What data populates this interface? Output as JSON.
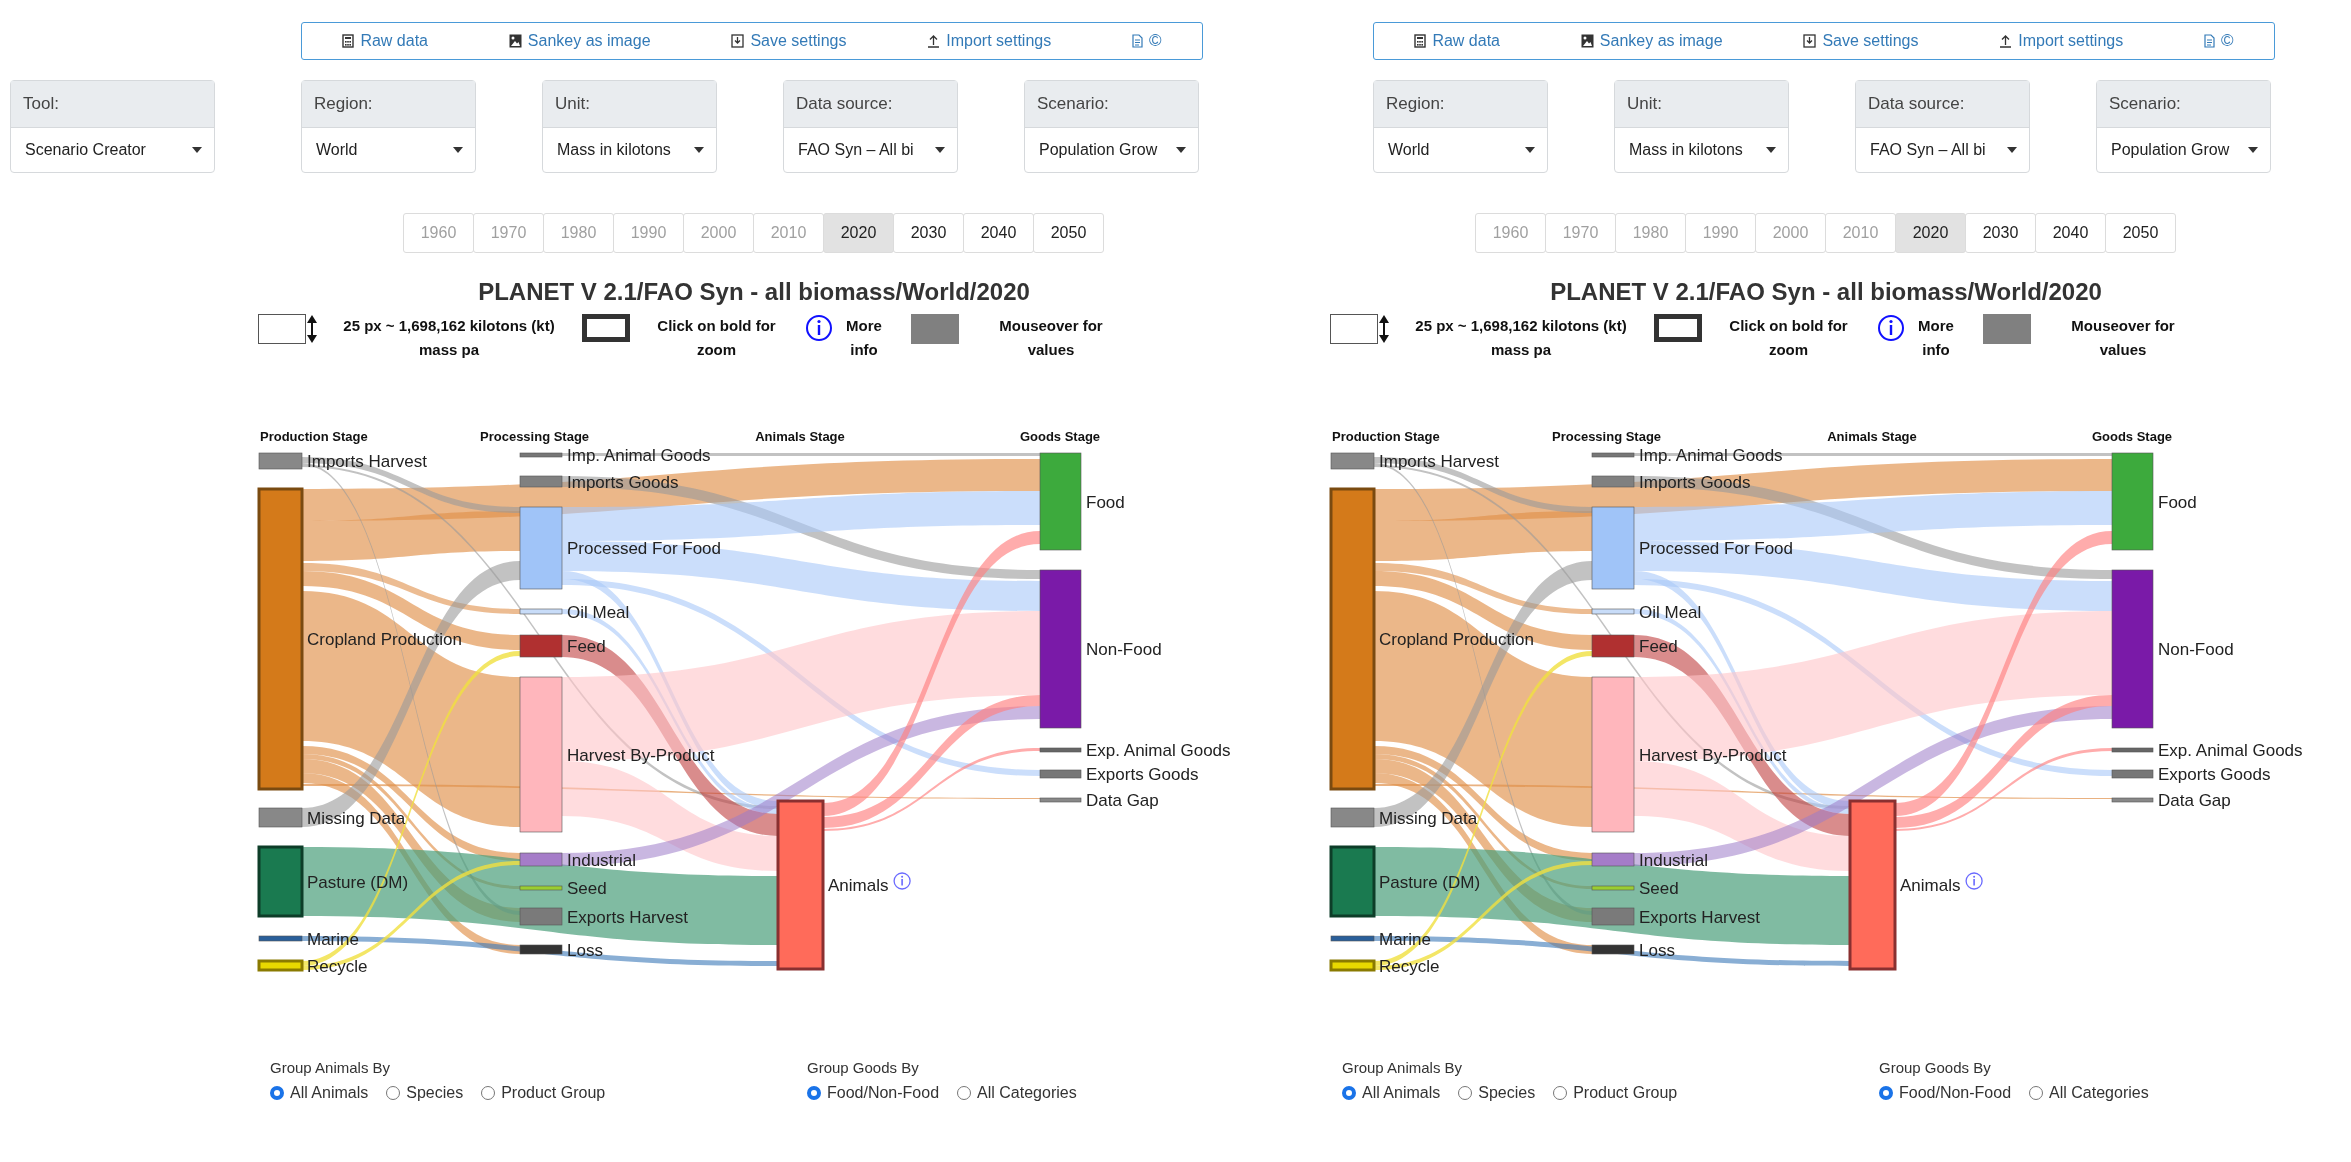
{
  "tool": {
    "label": "Tool:",
    "value": "Scenario Creator"
  },
  "panels": [
    {
      "toolbar": [
        {
          "kind": "calculator",
          "label": "Raw data"
        },
        {
          "kind": "image",
          "label": "Sankey as image"
        },
        {
          "kind": "save",
          "label": "Save settings"
        },
        {
          "kind": "upload",
          "label": "Import settings"
        }
      ],
      "license_mark": "©",
      "dropdowns": [
        {
          "label": "Region:",
          "value": "World"
        },
        {
          "label": "Unit:",
          "value": "Mass in kilotons"
        },
        {
          "label": "Data source:",
          "value": "FAO Syn – All bi"
        },
        {
          "label": "Scenario:",
          "value": "Population Grow"
        }
      ],
      "years": [
        {
          "label": "1960",
          "disabled": true,
          "selected": false
        },
        {
          "label": "1970",
          "disabled": true,
          "selected": false
        },
        {
          "label": "1980",
          "disabled": true,
          "selected": false
        },
        {
          "label": "1990",
          "disabled": true,
          "selected": false
        },
        {
          "label": "2000",
          "disabled": true,
          "selected": false
        },
        {
          "label": "2010",
          "disabled": true,
          "selected": false
        },
        {
          "label": "2020",
          "disabled": false,
          "selected": true
        },
        {
          "label": "2030",
          "disabled": false,
          "selected": false
        },
        {
          "label": "2040",
          "disabled": false,
          "selected": false
        },
        {
          "label": "2050",
          "disabled": false,
          "selected": false
        }
      ],
      "title": "PLANET V 2.1/FAO Syn - all biomass/World/2020",
      "legend": {
        "scale": "25 px ~ 1,698,162 kilotons (kt) mass pa",
        "zoom": "Click on bold for zoom",
        "info": "More info",
        "values": "Mouseover for values"
      },
      "sankey": {
        "stages": [
          {
            "title": "Production Stage",
            "nodes": [
              {
                "label": "Imports Harvest",
                "color": "#888888"
              },
              {
                "label": "Cropland Production",
                "color": "#d47a1a"
              },
              {
                "label": "Missing Data",
                "color": "#888888"
              },
              {
                "label": "Pasture (DM)",
                "color": "#1a7a50"
              },
              {
                "label": "Marine",
                "color": "#2a5f9a"
              },
              {
                "label": "Recycle",
                "color": "#e8d800"
              }
            ]
          },
          {
            "title": "Processing Stage",
            "nodes": [
              {
                "label": "Imp. Animal Goods",
                "color": "#777777"
              },
              {
                "label": "Imports Goods",
                "color": "#808080"
              },
              {
                "label": "Processed For Food",
                "color": "#a0c4f8"
              },
              {
                "label": "Oil Meal",
                "color": "#c8dcf8"
              },
              {
                "label": "Feed",
                "color": "#b03030"
              },
              {
                "label": "Harvest By-Product",
                "color": "#ffb6bc"
              },
              {
                "label": "Industrial",
                "color": "#a57cc8"
              },
              {
                "label": "Seed",
                "color": "#9acd32"
              },
              {
                "label": "Exports Harvest",
                "color": "#7a7a7a"
              },
              {
                "label": "Loss",
                "color": "#333333"
              }
            ]
          },
          {
            "title": "Animals Stage",
            "nodes": [
              {
                "label": "Animals",
                "color": "#ff6b5a",
                "info": true
              }
            ]
          },
          {
            "title": "Goods Stage",
            "nodes": [
              {
                "label": "Food",
                "color": "#3daa3d"
              },
              {
                "label": "Non-Food",
                "color": "#7a1aa8"
              },
              {
                "label": "Exp. Animal Goods",
                "color": "#666666"
              },
              {
                "label": "Exports Goods",
                "color": "#777777"
              },
              {
                "label": "Data Gap",
                "color": "#888888"
              }
            ]
          }
        ]
      },
      "radio_groups": [
        {
          "title": "Group Animals By",
          "options": [
            {
              "label": "All Animals",
              "selected": true
            },
            {
              "label": "Species",
              "selected": false
            },
            {
              "label": "Product Group",
              "selected": false
            }
          ]
        },
        {
          "title": "Group Goods By",
          "options": [
            {
              "label": "Food/Non-Food",
              "selected": true
            },
            {
              "label": "All Categories",
              "selected": false
            }
          ]
        }
      ]
    },
    {
      "toolbar": [
        {
          "kind": "calculator",
          "label": "Raw data"
        },
        {
          "kind": "image",
          "label": "Sankey as image"
        },
        {
          "kind": "save",
          "label": "Save settings"
        },
        {
          "kind": "upload",
          "label": "Import settings"
        }
      ],
      "license_mark": "©",
      "dropdowns": [
        {
          "label": "Region:",
          "value": "World"
        },
        {
          "label": "Unit:",
          "value": "Mass in kilotons"
        },
        {
          "label": "Data source:",
          "value": "FAO Syn – All bi"
        },
        {
          "label": "Scenario:",
          "value": "Population Grow"
        }
      ],
      "years": [
        {
          "label": "1960",
          "disabled": true,
          "selected": false
        },
        {
          "label": "1970",
          "disabled": true,
          "selected": false
        },
        {
          "label": "1980",
          "disabled": true,
          "selected": false
        },
        {
          "label": "1990",
          "disabled": true,
          "selected": false
        },
        {
          "label": "2000",
          "disabled": true,
          "selected": false
        },
        {
          "label": "2010",
          "disabled": true,
          "selected": false
        },
        {
          "label": "2020",
          "disabled": false,
          "selected": true
        },
        {
          "label": "2030",
          "disabled": false,
          "selected": false
        },
        {
          "label": "2040",
          "disabled": false,
          "selected": false
        },
        {
          "label": "2050",
          "disabled": false,
          "selected": false
        }
      ],
      "title": "PLANET V 2.1/FAO Syn - all biomass/World/2020",
      "legend": {
        "scale": "25 px ~ 1,698,162 kilotons (kt) mass pa",
        "zoom": "Click on bold for zoom",
        "info": "More info",
        "values": "Mouseover for values"
      },
      "sankey": {
        "stages": [
          {
            "title": "Production Stage",
            "nodes": [
              {
                "label": "Imports Harvest",
                "color": "#888888"
              },
              {
                "label": "Cropland Production",
                "color": "#d47a1a"
              },
              {
                "label": "Missing Data",
                "color": "#888888"
              },
              {
                "label": "Pasture (DM)",
                "color": "#1a7a50"
              },
              {
                "label": "Marine",
                "color": "#2a5f9a"
              },
              {
                "label": "Recycle",
                "color": "#e8d800"
              }
            ]
          },
          {
            "title": "Processing Stage",
            "nodes": [
              {
                "label": "Imp. Animal Goods",
                "color": "#777777"
              },
              {
                "label": "Imports Goods",
                "color": "#808080"
              },
              {
                "label": "Processed For Food",
                "color": "#a0c4f8"
              },
              {
                "label": "Oil Meal",
                "color": "#c8dcf8"
              },
              {
                "label": "Feed",
                "color": "#b03030"
              },
              {
                "label": "Harvest By-Product",
                "color": "#ffb6bc"
              },
              {
                "label": "Industrial",
                "color": "#a57cc8"
              },
              {
                "label": "Seed",
                "color": "#9acd32"
              },
              {
                "label": "Exports Harvest",
                "color": "#7a7a7a"
              },
              {
                "label": "Loss",
                "color": "#333333"
              }
            ]
          },
          {
            "title": "Animals Stage",
            "nodes": [
              {
                "label": "Animals",
                "color": "#ff6b5a",
                "info": true
              }
            ]
          },
          {
            "title": "Goods Stage",
            "nodes": [
              {
                "label": "Food",
                "color": "#3daa3d"
              },
              {
                "label": "Non-Food",
                "color": "#7a1aa8"
              },
              {
                "label": "Exp. Animal Goods",
                "color": "#666666"
              },
              {
                "label": "Exports Goods",
                "color": "#777777"
              },
              {
                "label": "Data Gap",
                "color": "#888888"
              }
            ]
          }
        ]
      },
      "radio_groups": [
        {
          "title": "Group Animals By",
          "options": [
            {
              "label": "All Animals",
              "selected": true
            },
            {
              "label": "Species",
              "selected": false
            },
            {
              "label": "Product Group",
              "selected": false
            }
          ]
        },
        {
          "title": "Group Goods By",
          "options": [
            {
              "label": "Food/Non-Food",
              "selected": true
            },
            {
              "label": "All Categories",
              "selected": false
            }
          ]
        }
      ]
    }
  ]
}
